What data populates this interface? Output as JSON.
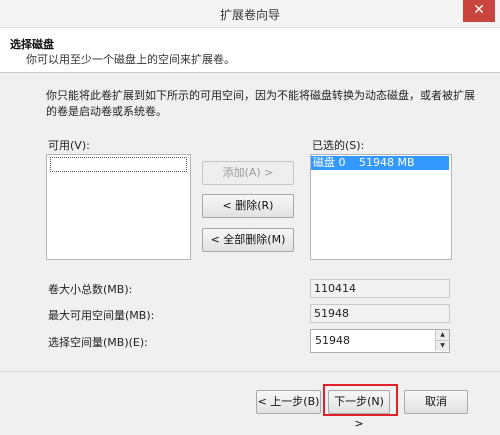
{
  "window": {
    "title": "扩展卷向导",
    "close_glyph": "✕"
  },
  "header": {
    "title": "选择磁盘",
    "subtitle": "你可以用至少一个磁盘上的空间来扩展卷。"
  },
  "description": "你只能将此卷扩展到如下所示的可用空间，因为不能将磁盘转换为动态磁盘，或者被扩展的卷是启动卷或系统卷。",
  "available": {
    "label": "可用(V):",
    "items": []
  },
  "selected": {
    "label": "已选的(S):",
    "items": [
      {
        "disk": "磁盘 0",
        "size": "51948 MB"
      }
    ]
  },
  "buttons": {
    "add": "添加(A) >",
    "remove": "< 删除(R)",
    "remove_all": "< 全部删除(M)"
  },
  "fields": {
    "total_label": "卷大小总数(MB):",
    "total_value": "110414",
    "max_label": "最大可用空间量(MB):",
    "max_value": "51948",
    "choose_label": "选择空间量(MB)(E):",
    "choose_value": "51948"
  },
  "footer": {
    "prev": "< 上一步(B)",
    "next": "下一步(N) >",
    "cancel": "取消"
  },
  "colors": {
    "selection": "#3399ff",
    "highlight_box": "#e0202c",
    "close": "#c7453c"
  }
}
